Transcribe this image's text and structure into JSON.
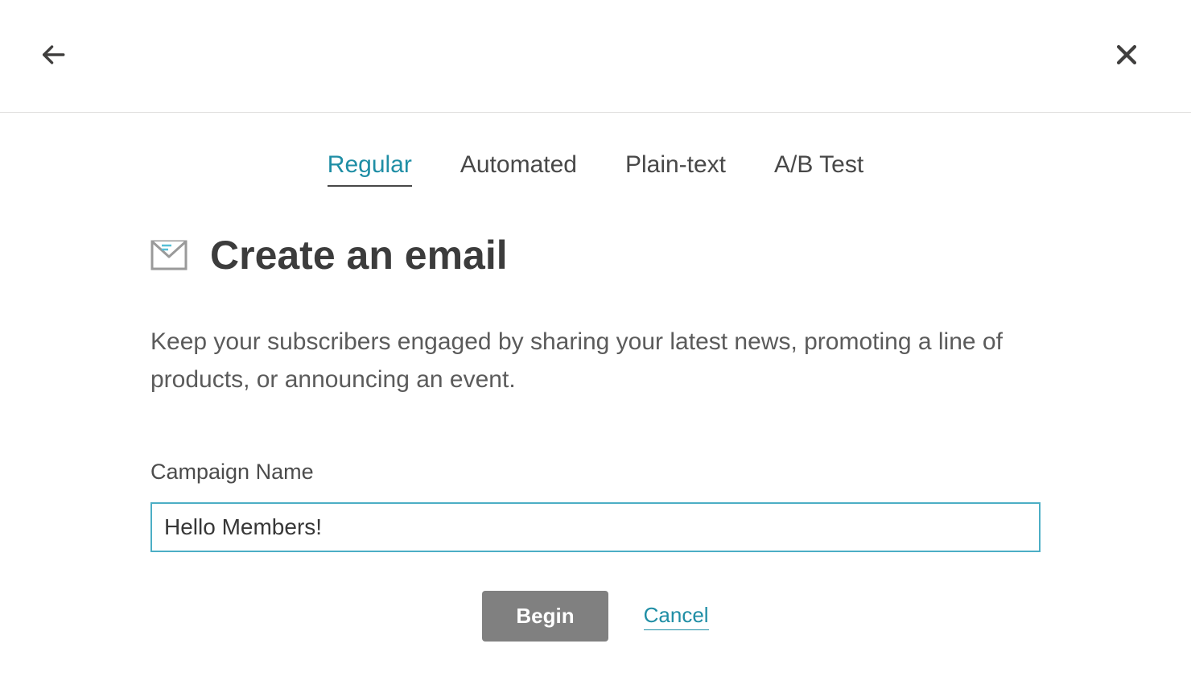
{
  "tabs": [
    {
      "label": "Regular",
      "active": true
    },
    {
      "label": "Automated",
      "active": false
    },
    {
      "label": "Plain-text",
      "active": false
    },
    {
      "label": "A/B Test",
      "active": false
    }
  ],
  "page": {
    "title": "Create an email",
    "description": "Keep your subscribers engaged by sharing your latest news, promoting a line of products, or announcing an event."
  },
  "form": {
    "campaign_name_label": "Campaign Name",
    "campaign_name_value": "Hello Members!"
  },
  "actions": {
    "begin_label": "Begin",
    "cancel_label": "Cancel"
  }
}
